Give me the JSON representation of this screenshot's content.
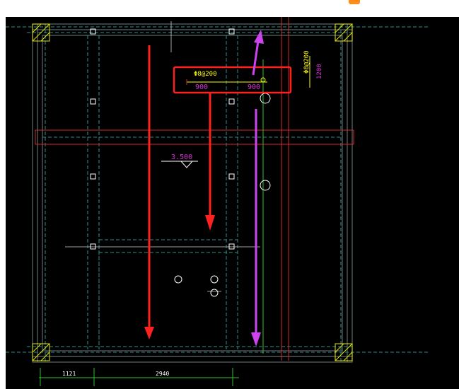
{
  "colors": {
    "background": "#000000",
    "page": "#ffffff",
    "frame": "#5a6b6b",
    "dashed": "#2f8f8f",
    "white": "#ffffff",
    "red": "#d42a2a",
    "magenta": "#d633d6",
    "green": "#2fbf2f",
    "yellow": "#ffff00",
    "yellow_col": "#e6e600",
    "arrow_red": "#ff2020",
    "arrow_magenta": "#cc44ee",
    "highlight": "#ff2020",
    "accent": "#ff8c1a"
  },
  "annotations": {
    "rebar_left": "Φ8@200",
    "dim_left": "900",
    "dim_right": "900",
    "rebar_right": "Φ8@200",
    "length_right": "1200",
    "elevation": "3.500",
    "bottom_dim_1": "1121",
    "bottom_dim_2": "2940"
  },
  "icons": {
    "corner_logo": "app-badge-icon",
    "columns": "column-hatch-icon",
    "posts": "post-square-icon",
    "holes": "hole-circle-icon",
    "elevation_marker": "elevation-triangle-icon"
  }
}
